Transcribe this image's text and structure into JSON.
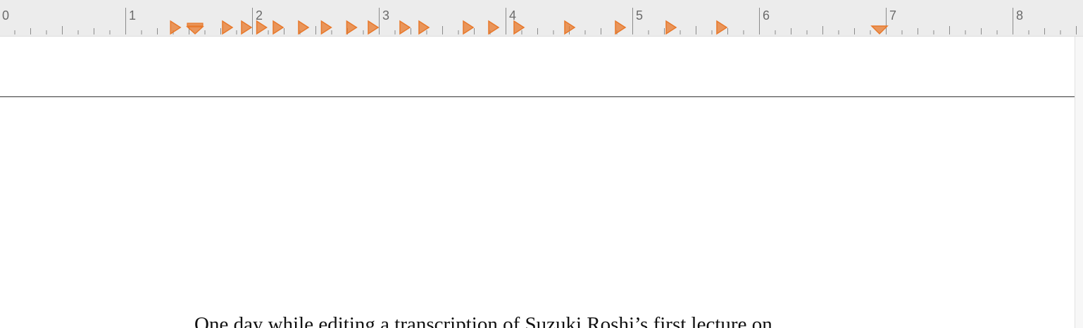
{
  "ruler": {
    "unit_numbers": [
      "0",
      "1",
      "2",
      "3",
      "4",
      "5",
      "6",
      "7",
      "8"
    ],
    "tab_stops": [
      0.39,
      0.8,
      0.95,
      1.07,
      1.2,
      1.4,
      1.58,
      1.78,
      1.95,
      2.2,
      2.35,
      2.7,
      2.9,
      3.1,
      3.5,
      3.9,
      4.3,
      4.7
    ],
    "first_line_indent": 0.55,
    "right_margin": 6.95,
    "marker_color": "#e8782a"
  },
  "document": {
    "body_text": "One day while editing a transcription of Suzuki Roshi’s first lecture on"
  }
}
